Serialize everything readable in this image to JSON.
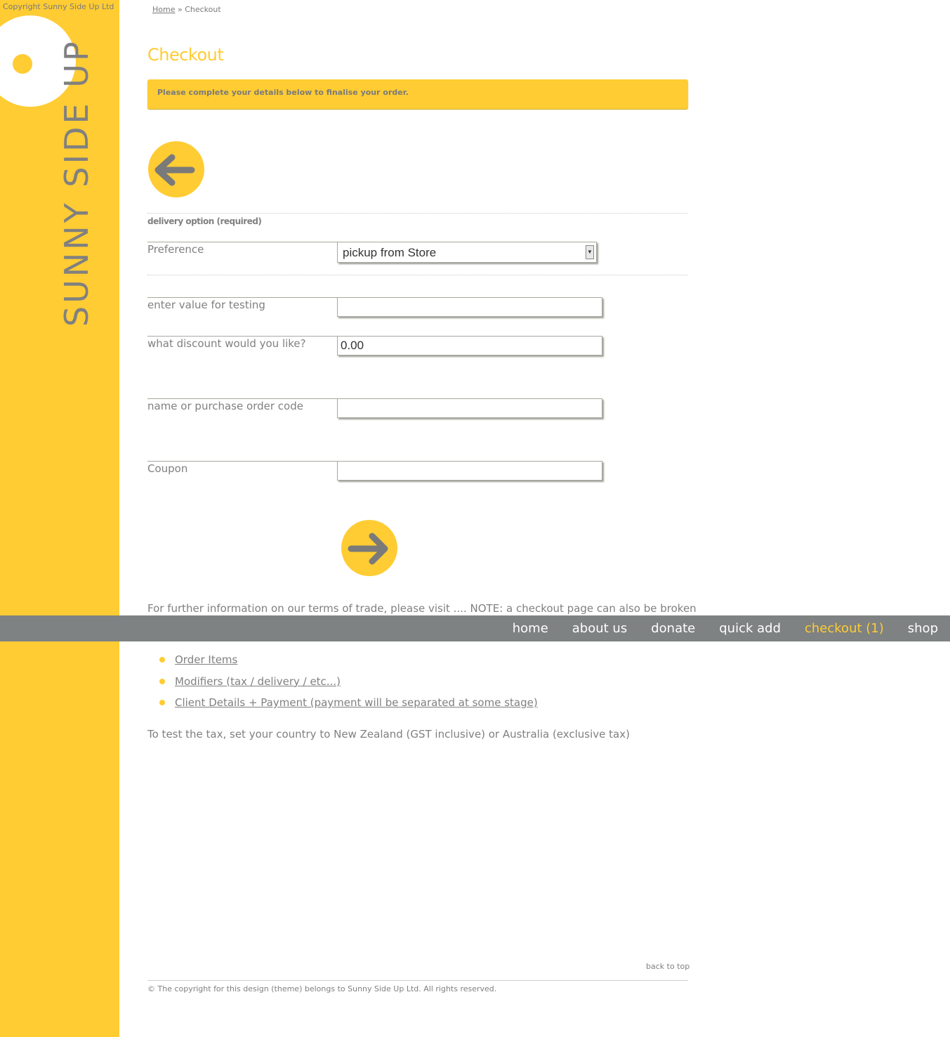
{
  "sidebar": {
    "copyright": "Copyright Sunny Side Up Ltd",
    "logo_text": "SUNNY SIDE UP"
  },
  "breadcrumb": {
    "home": "Home",
    "separator": "»",
    "current": "Checkout"
  },
  "page": {
    "title": "Checkout",
    "notice": "Please complete your details below to finalise your order."
  },
  "buttons": {
    "back_icon": "arrow-left-icon",
    "next_icon": "arrow-right-icon"
  },
  "form": {
    "legend": "delivery option (required)",
    "preference_label": "Preference",
    "preference_value": "pickup from Store",
    "test_label": "enter value for testing",
    "test_value": "",
    "discount_label": "what discount would you like?",
    "discount_value": "0.00",
    "name_label": "name or purchase order code",
    "name_value": "",
    "coupon_label": "Coupon",
    "coupon_value": ""
  },
  "terms": "For further information on our terms of trade, please visit .... NOTE: a checkout page can also be broken",
  "nav": {
    "items": [
      "home",
      "about us",
      "donate",
      "quick add",
      "checkout (1)",
      "shop"
    ],
    "active": "checkout (1)"
  },
  "links": [
    "Order Items",
    "Modifiers (tax / delivery / etc...)",
    "Client Details + Payment (payment will be separated at some stage)"
  ],
  "tax_note": "To test the tax, set your country to New Zealand (GST inclusive) or Australia (exclusive tax)",
  "footer": {
    "back_to_top": "back to top",
    "copyright": "© The copyright for this design (theme) belongs to Sunny Side Up Ltd. All rights reserved."
  },
  "colors": {
    "brand_yellow": "#ffcc33",
    "nav_grey": "#7f8282",
    "text_grey": "#808080"
  }
}
